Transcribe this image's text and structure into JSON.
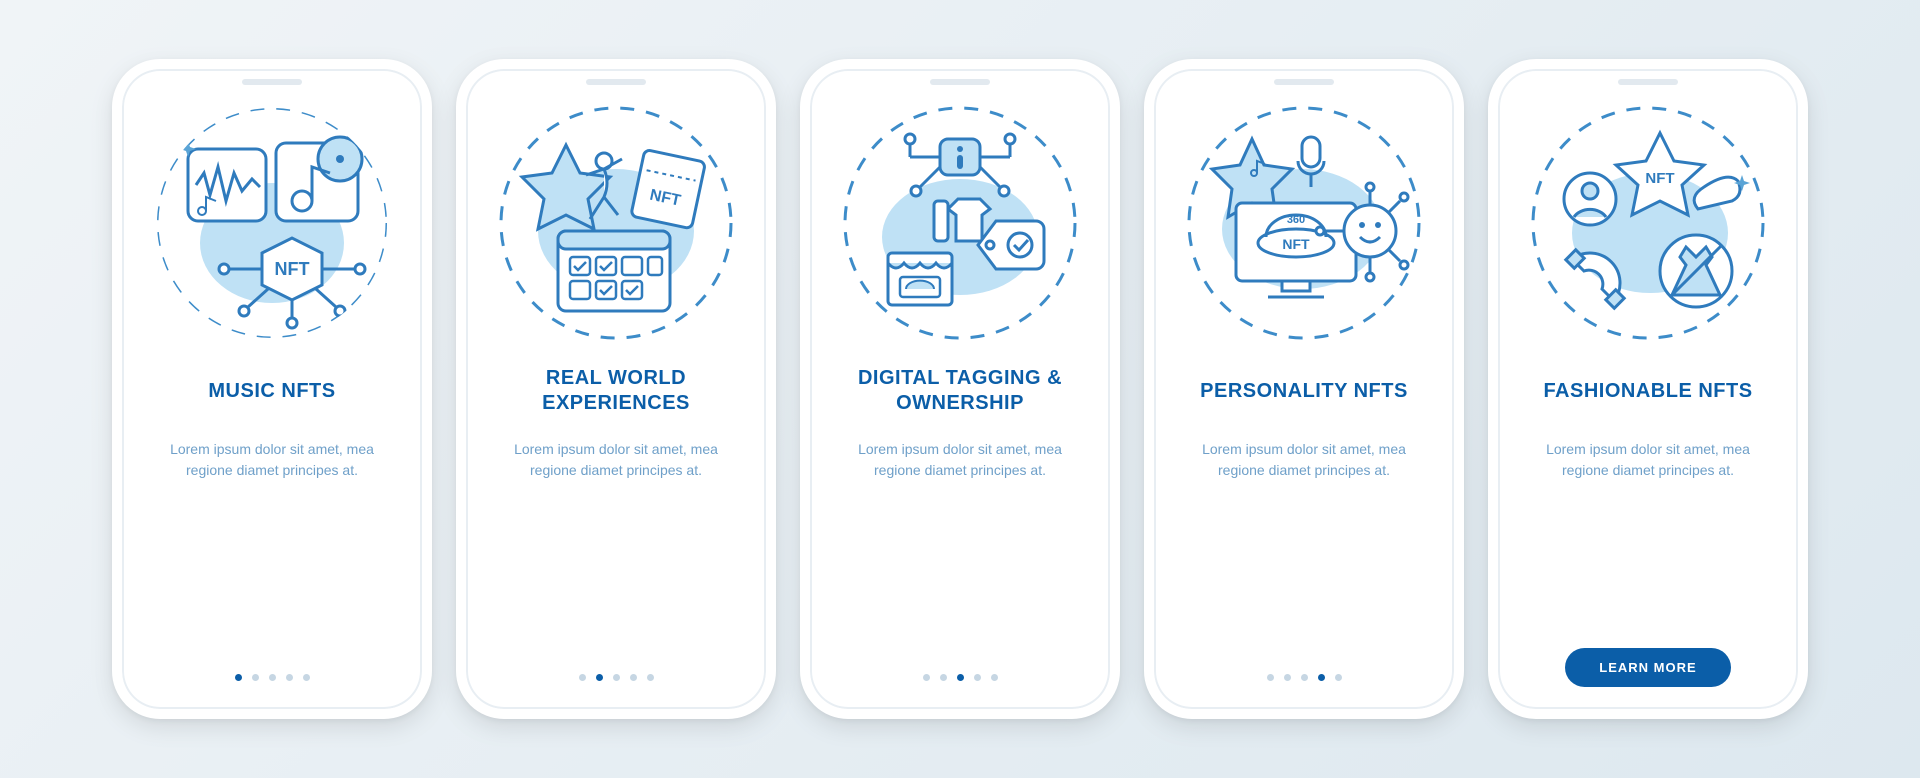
{
  "accent": "#0b5ea8",
  "screens": [
    {
      "icon": "music-nft-icon",
      "title": "MUSIC NFTS",
      "desc": "Lorem ipsum dolor sit amet, mea regione diamet principes at."
    },
    {
      "icon": "real-world-icon",
      "title": "REAL WORLD EXPERIENCES",
      "desc": "Lorem ipsum dolor sit amet, mea regione diamet principes at."
    },
    {
      "icon": "digital-tagging-icon",
      "title": "DIGITAL TAGGING & OWNERSHIP",
      "desc": "Lorem ipsum dolor sit amet, mea regione diamet principes at."
    },
    {
      "icon": "personality-nft-icon",
      "title": "PERSONALITY NFTS",
      "desc": "Lorem ipsum dolor sit amet, mea regione diamet principes at."
    },
    {
      "icon": "fashionable-nft-icon",
      "title": "FASHIONABLE NFTS",
      "desc": "Lorem ipsum dolor sit amet, mea regione diamet principes at."
    }
  ],
  "cta_label": "LEARN MORE",
  "dots_count": 5
}
